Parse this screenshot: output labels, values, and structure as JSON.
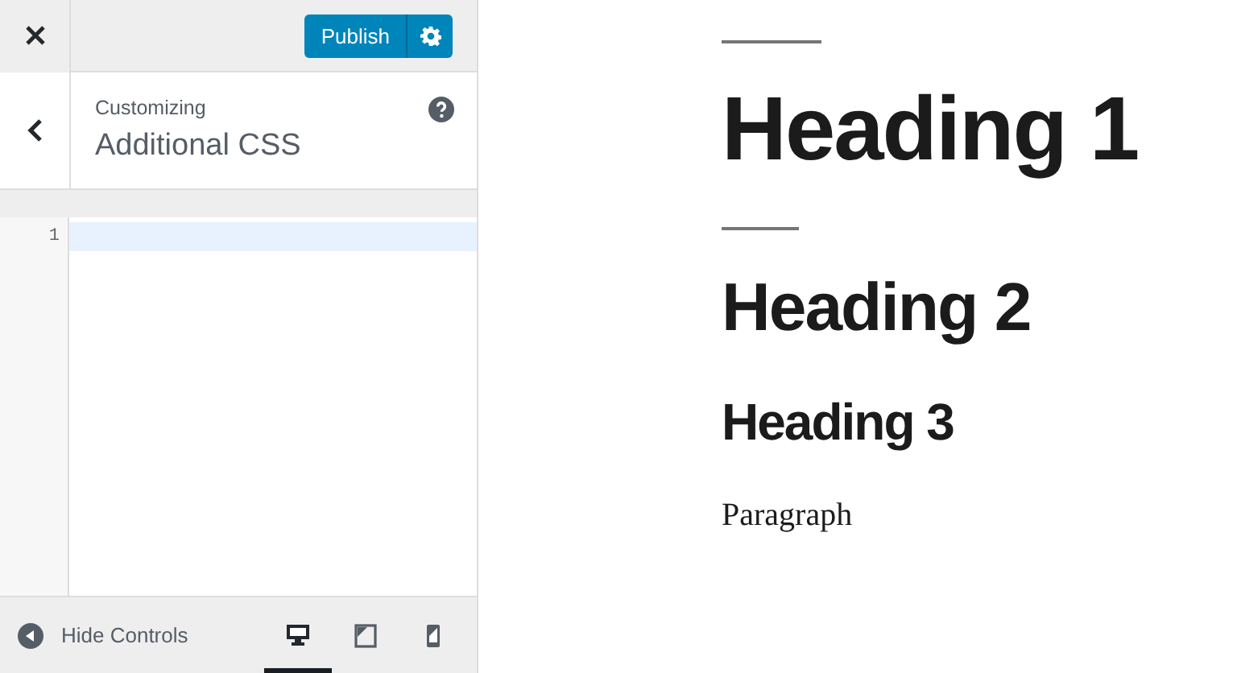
{
  "header": {
    "publish_label": "Publish"
  },
  "section": {
    "eyebrow": "Customizing",
    "title": "Additional CSS"
  },
  "editor": {
    "lines": [
      {
        "number": "1",
        "active": true
      }
    ]
  },
  "footer": {
    "hide_label": "Hide Controls",
    "devices": [
      {
        "kind": "desktop",
        "selected": true
      },
      {
        "kind": "tablet",
        "selected": false
      },
      {
        "kind": "mobile",
        "selected": false
      }
    ]
  },
  "preview": [
    {
      "kind": "rule"
    },
    {
      "kind": "h1",
      "text": "Heading 1"
    },
    {
      "kind": "rule"
    },
    {
      "kind": "h2",
      "text": "Heading 2"
    },
    {
      "kind": "h3",
      "text": "Heading 3"
    },
    {
      "kind": "p",
      "text": "Paragraph"
    }
  ]
}
